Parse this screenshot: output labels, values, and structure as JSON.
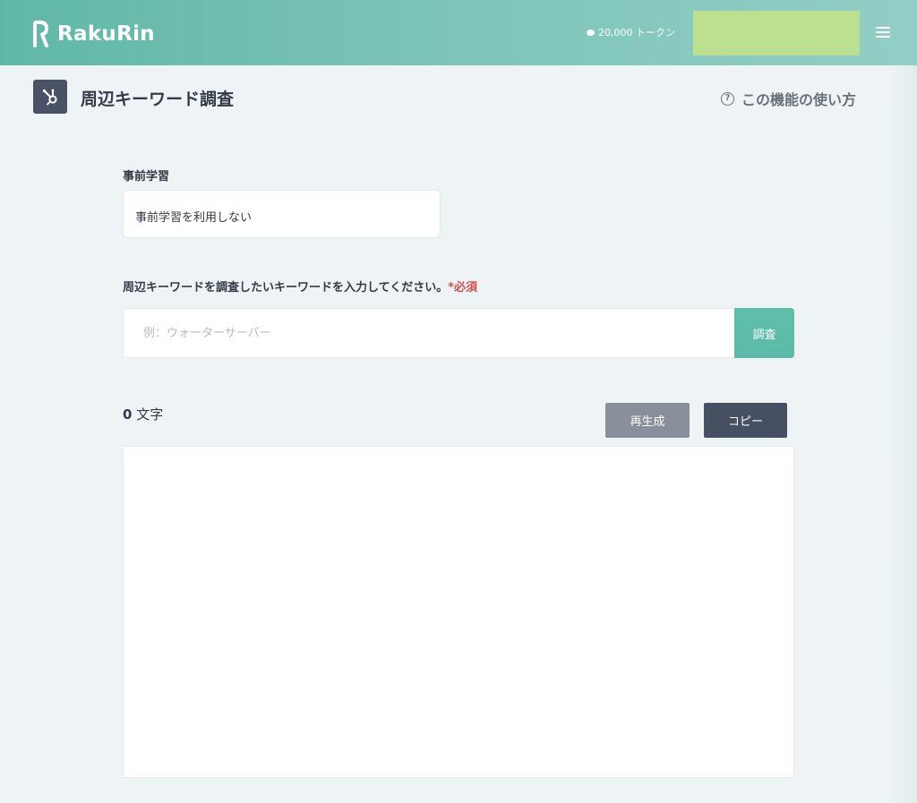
{
  "header": {
    "logo_text": "RakuRin",
    "tokens_label": "20,000 トークン",
    "user_box_color": "#bde090",
    "menu_icon": "hamburger-menu-icon"
  },
  "page": {
    "title": "周辺キーワード調査",
    "icon": "hubspot-sprocket-icon",
    "help_label": "この機能の使い方"
  },
  "prelearn": {
    "label": "事前学習",
    "selected": "事前学習を利用しない"
  },
  "keyword": {
    "label": "周辺キーワードを調査したいキーワードを入力してください。",
    "required_label": "*必須",
    "value": "",
    "placeholder": "例：ウォーターサーバー",
    "search_button": "調査"
  },
  "result": {
    "char_count": "0",
    "char_unit": "文字",
    "regenerate_button": "再生成",
    "copy_button": "コピー",
    "text": ""
  },
  "colors": {
    "accent": "#5fbfaa",
    "dark_button": "#474f62",
    "gray_button": "#8a909b",
    "required": "#d05050"
  }
}
